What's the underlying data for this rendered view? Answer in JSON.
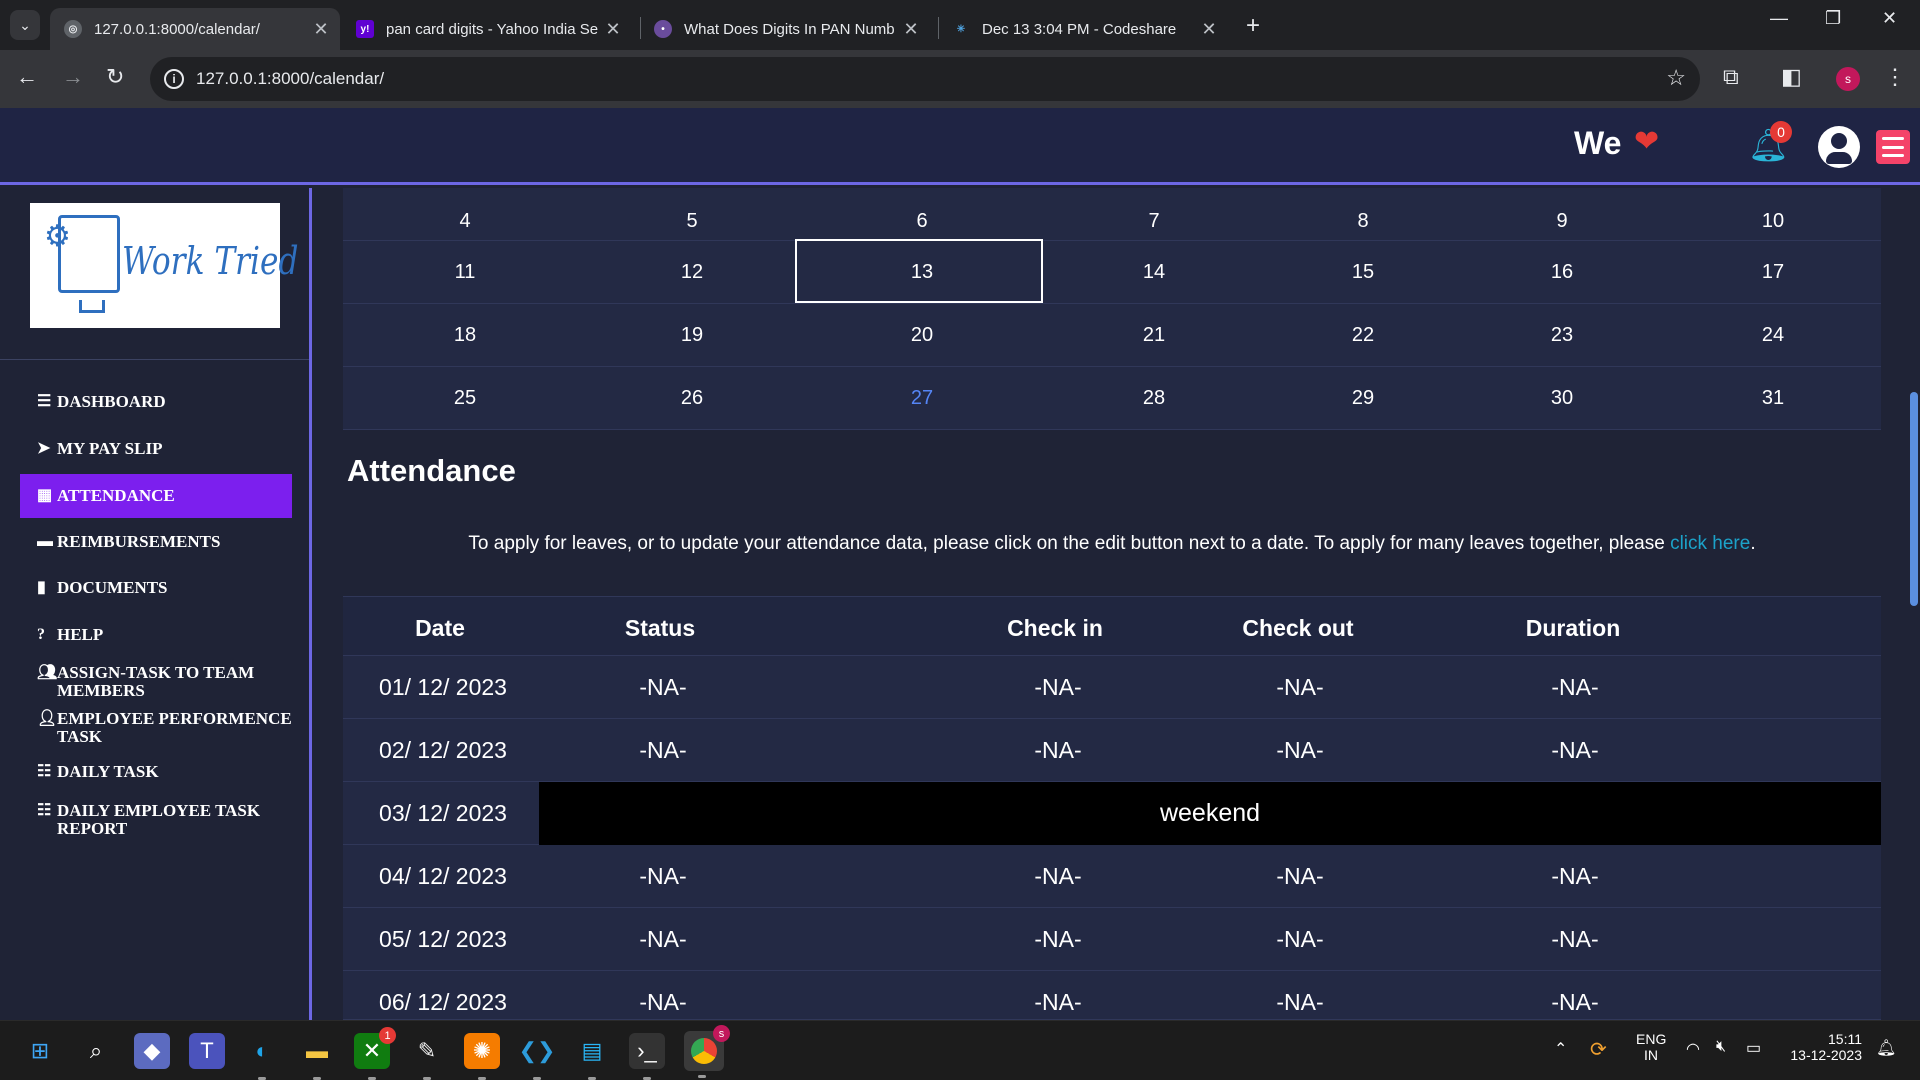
{
  "browser": {
    "tabs": [
      {
        "title": "127.0.0.1:8000/calendar/",
        "active": true
      },
      {
        "title": "pan card digits - Yahoo India Se",
        "active": false
      },
      {
        "title": "What Does Digits In PAN Numb",
        "active": false
      },
      {
        "title": "Dec 13 3:04 PM - Codeshare",
        "active": false
      }
    ],
    "url": "127.0.0.1:8000/calendar/",
    "profile_initial": "s"
  },
  "header": {
    "we_label": "We",
    "notification_count": "0"
  },
  "sidebar": {
    "logo_text": "Work Tried",
    "items": [
      {
        "label": "DASHBOARD"
      },
      {
        "label": "MY PAY SLIP"
      },
      {
        "label": "ATTENDANCE",
        "active": true
      },
      {
        "label": "REIMBURSEMENTS"
      },
      {
        "label": "DOCUMENTS"
      },
      {
        "label": "HELP"
      },
      {
        "label": "ASSIGN-TASK TO TEAM MEMBERS"
      },
      {
        "label": "EMPLOYEE PERFORMENCE TASK"
      },
      {
        "label": "DAILY TASK"
      },
      {
        "label": "DAILY EMPLOYEE TASK REPORT"
      }
    ]
  },
  "calendar": {
    "weeks": [
      [
        "4",
        "5",
        "6",
        "7",
        "8",
        "9",
        "10"
      ],
      [
        "11",
        "12",
        "13",
        "14",
        "15",
        "16",
        "17"
      ],
      [
        "18",
        "19",
        "20",
        "21",
        "22",
        "23",
        "24"
      ],
      [
        "25",
        "26",
        "27",
        "28",
        "29",
        "30",
        "31"
      ]
    ],
    "selected_day": "13",
    "highlighted_day": "27",
    "accent_color": "#5585f5"
  },
  "attendance": {
    "title": "Attendance",
    "info_text": "To apply for leaves, or to update your attendance data, please click on the edit button next to a date. To apply for many leaves together, please ",
    "info_link": "click here",
    "info_end": ".",
    "columns": [
      "Date",
      "Status",
      "Check in",
      "Check out",
      "Duration"
    ],
    "rows": [
      {
        "date": "01/ 12/ 2023",
        "status": "-NA-",
        "check_in": "-NA-",
        "check_out": "-NA-",
        "duration": "-NA-"
      },
      {
        "date": "02/ 12/ 2023",
        "status": "-NA-",
        "check_in": "-NA-",
        "check_out": "-NA-",
        "duration": "-NA-"
      },
      {
        "date": "03/ 12/ 2023",
        "weekend": "weekend"
      },
      {
        "date": "04/ 12/ 2023",
        "status": "-NA-",
        "check_in": "-NA-",
        "check_out": "-NA-",
        "duration": "-NA-"
      },
      {
        "date": "05/ 12/ 2023",
        "status": "-NA-",
        "check_in": "-NA-",
        "check_out": "-NA-",
        "duration": "-NA-"
      },
      {
        "date": "06/ 12/ 2023",
        "status": "-NA-",
        "check_in": "-NA-",
        "check_out": "-NA-",
        "duration": "-NA-"
      }
    ]
  },
  "taskbar": {
    "xbox_badge": "1",
    "chrome_badge": "s",
    "lang_1": "ENG",
    "lang_2": "IN",
    "time": "15:11",
    "date": "13-12-2023"
  }
}
